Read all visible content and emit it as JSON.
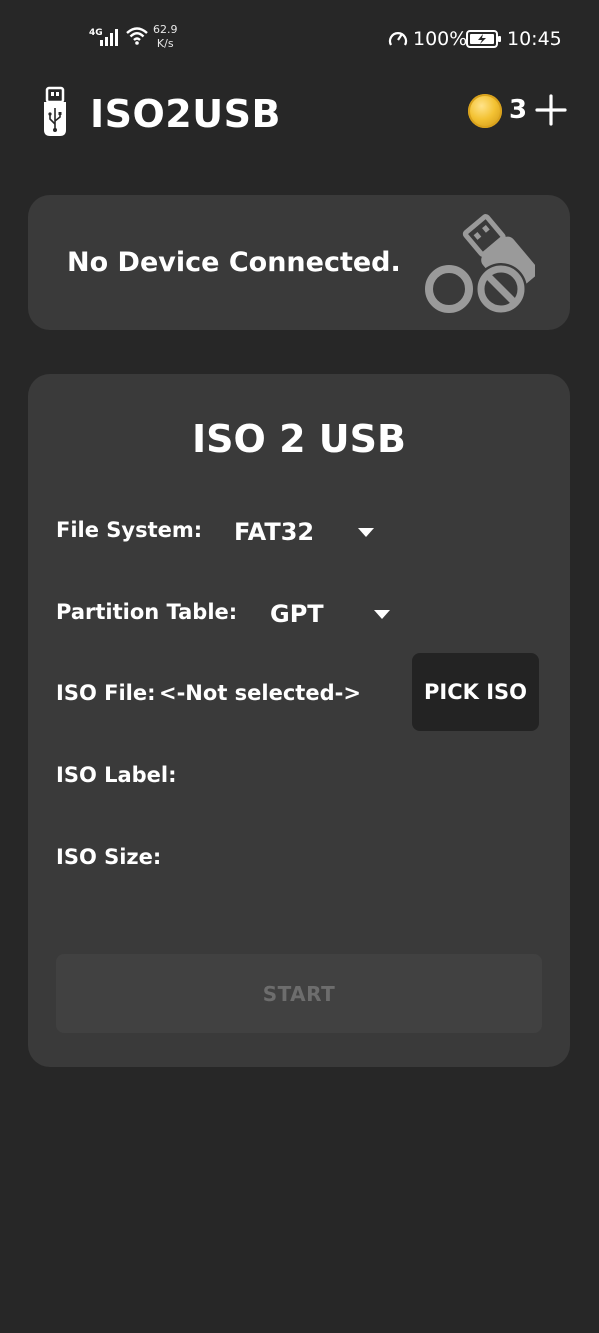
{
  "status_bar": {
    "network_type": "4G",
    "net_speed_value": "62.9",
    "net_speed_unit": "K/s",
    "battery_percent": "100%",
    "time": "10:45"
  },
  "header": {
    "app_title": "ISO2USB",
    "coin_count": "3"
  },
  "device": {
    "status_text": "No Device Connected."
  },
  "form": {
    "title": "ISO 2 USB",
    "file_system_label": "File System:",
    "file_system_value": "FAT32",
    "partition_table_label": "Partition Table:",
    "partition_table_value": "GPT",
    "iso_file_label": "ISO File:",
    "iso_file_value": "<-Not selected->",
    "pick_iso_label": "PICK ISO",
    "iso_label_label": "ISO Label:",
    "iso_size_label": "ISO Size:",
    "start_label": "START"
  },
  "colors": {
    "background": "#272727",
    "card": "#3a3a3a",
    "button_dark": "#232323",
    "disabled_button": "#414141",
    "disabled_text": "#6d6d6d",
    "coin": "#f3c233"
  },
  "icons": {
    "logo": "usb-stick-icon",
    "coin": "coin-icon",
    "add": "plus-icon",
    "device": "usb-blocked-icon",
    "dropdown": "chevron-down-icon"
  }
}
